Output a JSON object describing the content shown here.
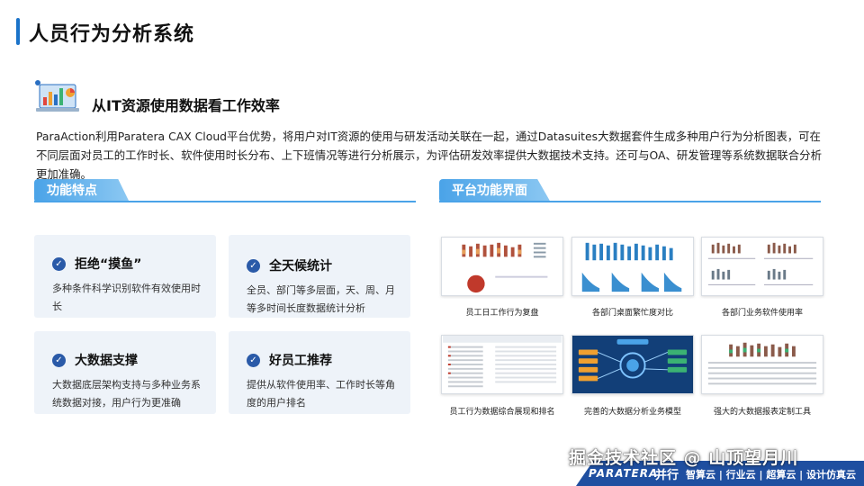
{
  "header": {
    "title": "人员行为分析系统"
  },
  "section": {
    "title": "从IT资源使用数据看工作效率",
    "description": "ParaAction利用Paratera CAX Cloud平台优势，将用户对IT资源的使用与研发活动关联在一起，通过Datasuites大数据套件生成多种用户行为分析图表，可在不同层面对员工的工作时长、软件使用时长分布、上下班情况等进行分析展示，为评估研发效率提供大数据技术支持。还可与OA、研发管理等系统数据联合分析更加准确。"
  },
  "features": {
    "tab_label": "功能特点",
    "items": [
      {
        "title": "拒绝“摸鱼”",
        "body": "多种条件科学识别软件有效使用时长"
      },
      {
        "title": "全天候统计",
        "body": "全员、部门等多层面，天、周、月等多时间长度数据统计分析"
      },
      {
        "title": "大数据支撑",
        "body": "大数据底层架构支持与多种业务系统数据对接，用户行为更准确"
      },
      {
        "title": "好员工推荐",
        "body": "提供从软件使用率、工作时长等角度的用户排名"
      }
    ]
  },
  "platform": {
    "tab_label": "平台功能界面",
    "screenshots": [
      {
        "caption": "员工日工作行为复盘"
      },
      {
        "caption": "各部门桌面繁忙度对比"
      },
      {
        "caption": "各部门业务软件使用率"
      },
      {
        "caption": "员工行为数据综合展现和排名"
      },
      {
        "caption": "完善的大数据分析业务模型"
      },
      {
        "caption": "强大的大数据报表定制工具"
      }
    ]
  },
  "footer": {
    "brand": "PARATERA",
    "brand_cn": "并行",
    "tagline": "智算云 | 行业云 | 超算云 | 设计仿真云",
    "watermark": "掘金技术社区 @ 山顶望月川"
  },
  "colors": {
    "accent": "#1a73c9",
    "tab": "#4aa3e8",
    "card_bg": "#eef3f9",
    "footer": "#1f4fa0"
  }
}
